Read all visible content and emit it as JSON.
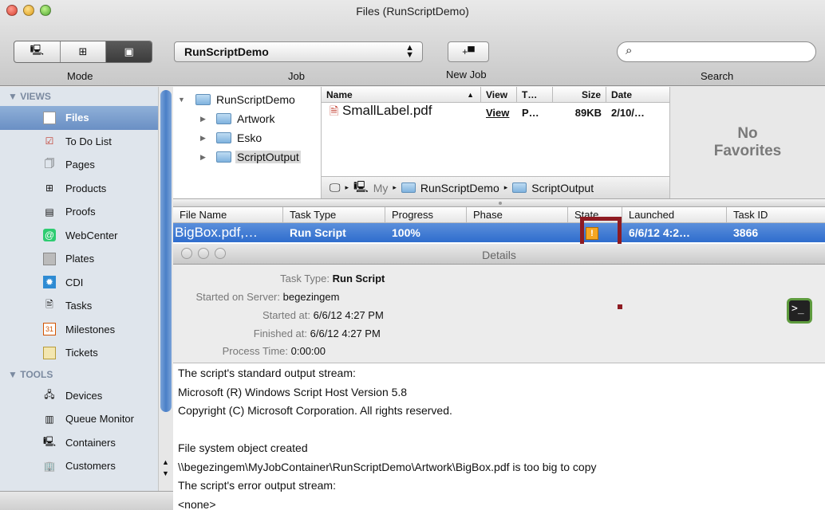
{
  "window": {
    "title": "Files (RunScriptDemo)"
  },
  "toolbar": {
    "mode_label": "Mode",
    "job_label": "Job",
    "job_value": "RunScriptDemo",
    "newjob_label": "New Job",
    "search_label": "Search",
    "search_value": ""
  },
  "sidebar": {
    "sections": [
      {
        "label": "▼ VIEWS",
        "items": [
          {
            "label": "Files",
            "icon": "file-icon",
            "selected": true
          },
          {
            "label": "To Do List",
            "icon": "checkbox-icon"
          },
          {
            "label": "Pages",
            "icon": "pages-icon"
          },
          {
            "label": "Products",
            "icon": "products-icon"
          },
          {
            "label": "Proofs",
            "icon": "proofs-icon"
          },
          {
            "label": "WebCenter",
            "icon": "webcenter-icon"
          },
          {
            "label": "Plates",
            "icon": "plates-icon"
          },
          {
            "label": "CDI",
            "icon": "cdi-icon"
          },
          {
            "label": "Tasks",
            "icon": "tasks-icon"
          },
          {
            "label": "Milestones",
            "icon": "calendar-icon"
          },
          {
            "label": "Tickets",
            "icon": "tickets-icon"
          }
        ]
      },
      {
        "label": "▼ TOOLS",
        "items": [
          {
            "label": "Devices",
            "icon": "devices-icon"
          },
          {
            "label": "Queue Monitor",
            "icon": "queue-icon"
          },
          {
            "label": "Containers",
            "icon": "containers-icon"
          },
          {
            "label": "Customers",
            "icon": "customers-icon"
          }
        ]
      }
    ]
  },
  "tree": {
    "root": "RunScriptDemo",
    "children": [
      "Artwork",
      "Esko",
      "ScriptOutput"
    ]
  },
  "filelist": {
    "columns": [
      "Name",
      "View",
      "T…",
      "Size",
      "Date"
    ],
    "rows": [
      {
        "name": "SmallLabel.pdf",
        "view": "View",
        "type": "P…",
        "size": "89KB",
        "date": "2/10/…"
      }
    ],
    "path": [
      "My",
      "RunScriptDemo",
      "ScriptOutput"
    ]
  },
  "favorites": {
    "line1": "No",
    "line2": "Favorites"
  },
  "tasks": {
    "columns": [
      "File Name",
      "Task Type",
      "Progress",
      "Phase",
      "State",
      "Launched",
      "Task ID"
    ],
    "rows": [
      {
        "file": "BigBox.pdf,…",
        "type": "Run Script",
        "progress": "100%",
        "phase": "",
        "state": "!",
        "launched": "6/6/12 4:2…",
        "id": "3866"
      }
    ]
  },
  "details": {
    "title": "Details",
    "fields": [
      {
        "key": "Task Type:",
        "value": "Run Script"
      },
      {
        "key": "Started on Server:",
        "value": "begezingem"
      },
      {
        "key": "Started at:",
        "value": "6/6/12 4:27 PM"
      },
      {
        "key": "Finished at:",
        "value": "6/6/12 4:27 PM"
      },
      {
        "key": "Process Time:",
        "value": "0:00:00"
      }
    ],
    "terminal_glyph": ">_",
    "output": [
      "The script's standard output stream:",
      "Microsoft (R) Windows Script Host Version 5.8",
      "Copyright (C) Microsoft Corporation. All rights reserved.",
      "",
      "File system object created",
      "\\\\begezingem\\MyJobContainer\\RunScriptDemo\\Artwork\\BigBox.pdf is too big to copy",
      "The script's error output stream:",
      "<none>"
    ]
  },
  "colors": {
    "selection_blue": "#3b77d3",
    "highlight_red": "#8e1b22",
    "warning_orange": "#f5a623"
  }
}
